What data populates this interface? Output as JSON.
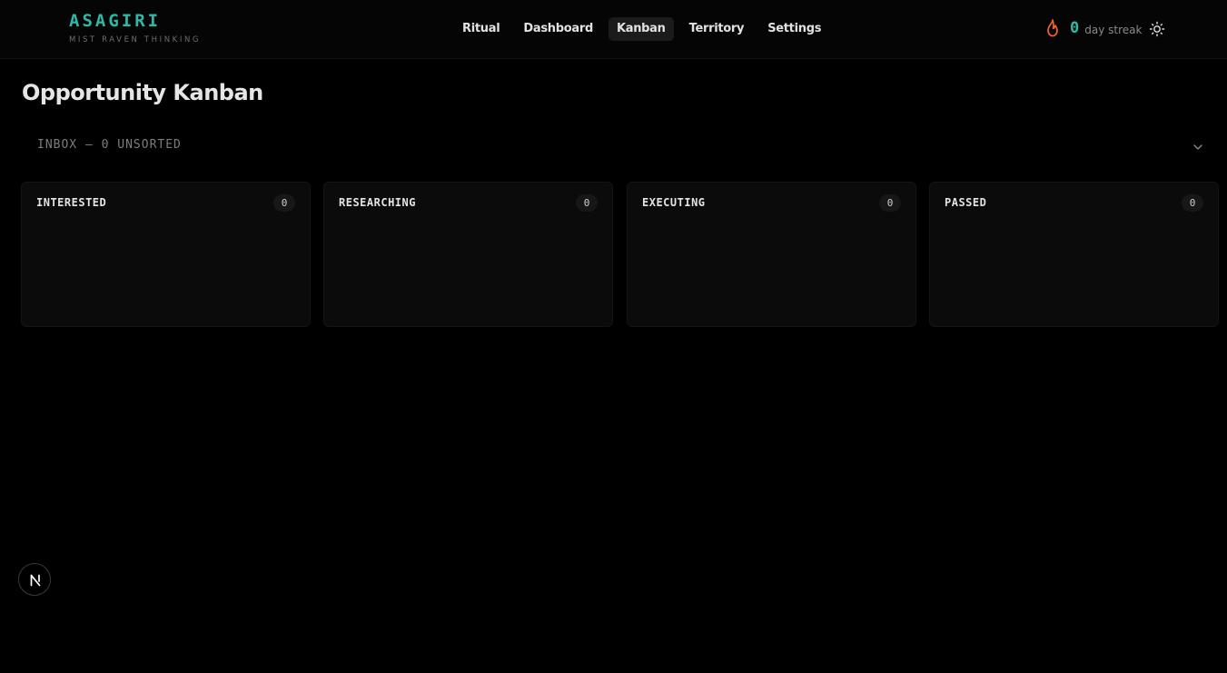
{
  "brand": {
    "name": "ASAGIRI",
    "tagline": "MIST RAVEN THINKING",
    "accent_color": "#2fb8a8"
  },
  "nav": {
    "items": [
      {
        "label": "Ritual",
        "active": false
      },
      {
        "label": "Dashboard",
        "active": false
      },
      {
        "label": "Kanban",
        "active": true
      },
      {
        "label": "Territory",
        "active": false
      },
      {
        "label": "Settings",
        "active": false
      }
    ]
  },
  "streak": {
    "icon": "flame-icon",
    "count": "0",
    "label": "day streak",
    "flame_color": "#f2642a"
  },
  "theme_toggle": {
    "icon": "sun-icon"
  },
  "page": {
    "title": "Opportunity Kanban"
  },
  "inbox": {
    "label": "INBOX — 0 UNSORTED",
    "icon": "chevron-down-icon"
  },
  "columns": [
    {
      "title": "INTERESTED",
      "count": "0"
    },
    {
      "title": "RESEARCHING",
      "count": "0"
    },
    {
      "title": "EXECUTING",
      "count": "0"
    },
    {
      "title": "PASSED",
      "count": "0"
    }
  ],
  "dev_badge": {
    "icon": "n-logo-icon"
  }
}
